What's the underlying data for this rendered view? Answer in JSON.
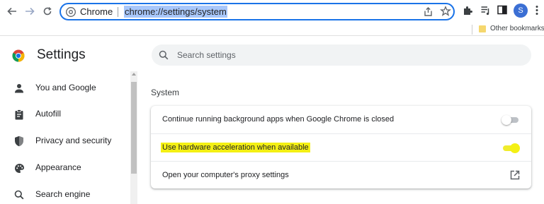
{
  "toolbar": {
    "back_icon": "arrow-left-icon",
    "forward_icon": "arrow-right-icon",
    "reload_icon": "reload-icon",
    "omnibox_label": "Chrome",
    "url": "chrome://settings/system",
    "avatar_letter": "S"
  },
  "bookmarks": {
    "other_label": "Other bookmarks"
  },
  "settings": {
    "title": "Settings",
    "search_placeholder": "Search settings"
  },
  "sidebar": {
    "items": [
      {
        "label": "You and Google",
        "icon": "person-icon"
      },
      {
        "label": "Autofill",
        "icon": "clipboard-icon"
      },
      {
        "label": "Privacy and security",
        "icon": "shield-icon"
      },
      {
        "label": "Appearance",
        "icon": "palette-icon"
      },
      {
        "label": "Search engine",
        "icon": "search-icon"
      }
    ]
  },
  "main": {
    "section_title": "System",
    "rows": [
      {
        "label": "Continue running background apps when Google Chrome is closed",
        "control": "toggle",
        "state": "off"
      },
      {
        "label": "Use hardware acceleration when available",
        "control": "toggle",
        "state": "highlighted"
      },
      {
        "label": "Open your computer's proxy settings",
        "control": "external-link"
      }
    ]
  },
  "colors": {
    "accent": "#1a73e8",
    "highlight": "#f4f014"
  }
}
